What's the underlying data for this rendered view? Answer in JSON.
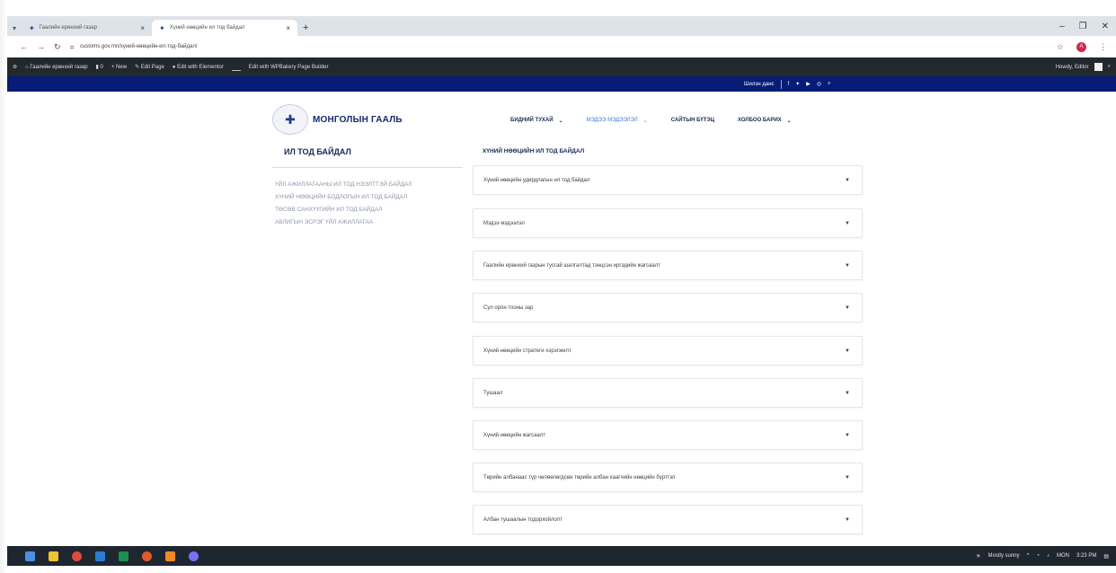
{
  "browser": {
    "tabs": [
      {
        "title": "Гаалийн ерөнхий газар",
        "active": false
      },
      {
        "title": "Хүний нөөцийн ил тод байдал",
        "active": true
      }
    ],
    "new_tab": "+",
    "url": "customs.gov.mn/хүний-нөөцийн-ил-тод-байдал/",
    "profile_initial": "A"
  },
  "wp_admin_bar": {
    "site_name": "Гаалийн ерөнхий газар",
    "comments": "0",
    "new_label": "New",
    "edit_page": "Edit Page",
    "edit_elementor": "Edit with Elementor",
    "edit_wpbakery": "Edit with WPBakery Page Builder",
    "howdy": "Howdy, Editor"
  },
  "topbar": {
    "link": "Шилэн данс"
  },
  "header": {
    "logo_text": "МОНГОЛЫН ГААЛЬ",
    "nav": [
      {
        "label": "БИДНИЙ ТУХАЙ",
        "active": false
      },
      {
        "label": "МЭДЭЭ МЭДЭЭЛЭЛ",
        "active": true
      },
      {
        "label": "САЙТЫН БҮТЭЦ",
        "active": false
      },
      {
        "label": "ХОЛБОО БАРИХ",
        "active": false
      }
    ]
  },
  "sidebar": {
    "title": "ИЛ ТОД БАЙДАЛ",
    "links": [
      "Үйл ажиллагааны ил тод нээлттэй байдал",
      "Хүний нөөцийн бодлогын ил тод байдал",
      "Төсөв санхүүгийн ил тод байдал",
      "Авлигын эсрэг үйл ажиллагаа"
    ]
  },
  "content": {
    "title": "ХҮНИЙ НӨӨЦИЙН ИЛ ТОД БАЙДАЛ",
    "accordion": [
      "Хүний нөөцийн удирдлагын ил тод байдал",
      "Мэдээ мэдээлэл",
      "Гаалийн ерөнхий газрын тусгай шалгалтад тэнцсэн иргэдийн жагсаалт",
      "Сул орон тооны зар",
      "Хүний нөөцийн стратеги хэрэгжилт",
      "Тушаал",
      "Хүний нөөцийн жагсаалт",
      "Төрийн албанаас түр чөлөөлөгдсөн төрийн албан хаагчийн нөөцийн бүртгэл",
      "Албан тушаалын тодорхойлолт"
    ]
  },
  "taskbar": {
    "weather": "Mostly sunny",
    "lang": "MON",
    "time": "3:23 PM"
  },
  "colors": {
    "admin_bar": "#23282d",
    "top_strip": "#061c76",
    "brand": "#152a6e",
    "nav_active": "#3c78d8",
    "taskbar": "#1e2630"
  }
}
